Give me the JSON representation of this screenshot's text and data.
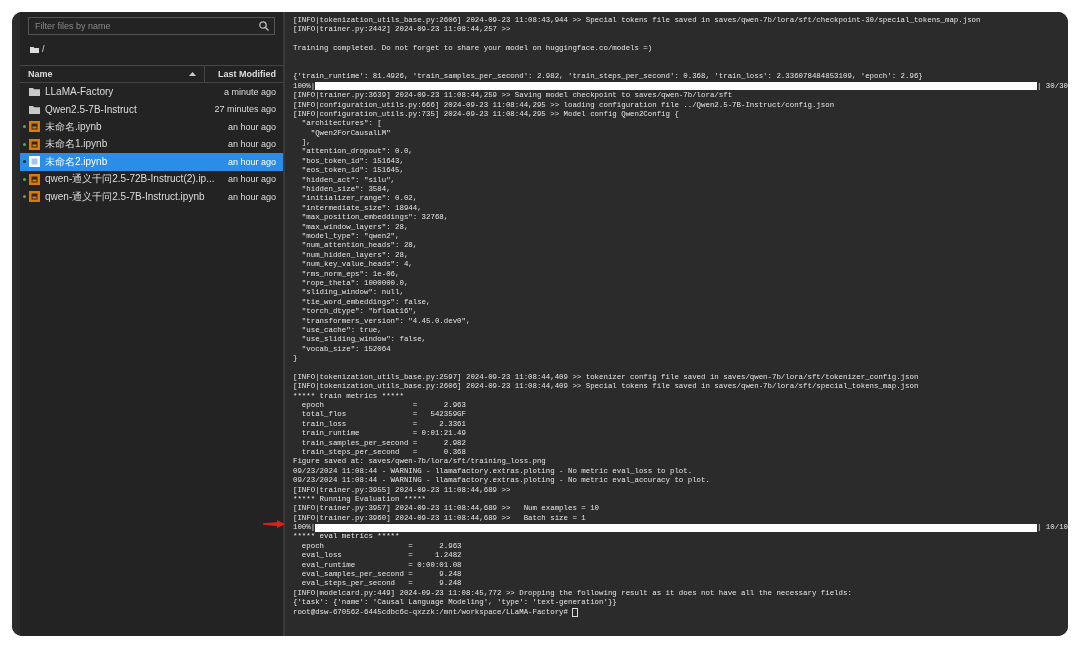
{
  "sidebar": {
    "search": {
      "placeholder": "Filter files by name"
    },
    "breadcrumb": "/",
    "columns": [
      {
        "label": "Name",
        "sorted": true
      },
      {
        "label": "Last Modified",
        "sorted": false
      }
    ],
    "files": [
      {
        "kind": "folder",
        "name": "LLaMA-Factory",
        "modified": "a minute ago",
        "running": false,
        "selected": false
      },
      {
        "kind": "folder",
        "name": "Qwen2.5-7B-Instruct",
        "modified": "27 minutes ago",
        "running": false,
        "selected": false
      },
      {
        "kind": "notebook",
        "name": "未命名.ipynb",
        "modified": "an hour ago",
        "running": true,
        "selected": false
      },
      {
        "kind": "notebook",
        "name": "未命名1.ipynb",
        "modified": "an hour ago",
        "running": true,
        "selected": false
      },
      {
        "kind": "notebook",
        "name": "未命名2.ipynb",
        "modified": "an hour ago",
        "running": true,
        "selected": true
      },
      {
        "kind": "notebook",
        "name": "qwen-通义千问2.5-72B-Instruct(2).ip...",
        "modified": "an hour ago",
        "running": true,
        "selected": false
      },
      {
        "kind": "notebook",
        "name": "qwen-通义千问2.5-7B-Instruct.ipynb",
        "modified": "an hour ago",
        "running": true,
        "selected": false
      }
    ]
  },
  "terminal": {
    "lines": [
      {
        "kind": "text",
        "text": "[INFO|tokenization_utils_base.py:2606] 2024-09-23 11:08:43,944 >> Special tokens file saved in saves/qwen-7b/lora/sft/checkpoint-30/special_tokens_map.json"
      },
      {
        "kind": "text",
        "text": "[INFO|trainer.py:2442] 2024-09-23 11:08:44,257 >>"
      },
      {
        "kind": "blank"
      },
      {
        "kind": "text",
        "text": "Training completed. Do not forget to share your model on huggingface.co/models =)"
      },
      {
        "kind": "blank"
      },
      {
        "kind": "blank"
      },
      {
        "kind": "text",
        "text": "{'train_runtime': 81.4926, 'train_samples_per_second': 2.982, 'train_steps_per_second': 0.368, 'train_loss': 2.336078484853109, 'epoch': 2.96}"
      },
      {
        "kind": "progress",
        "prefix": "100%|",
        "level": 1,
        "suffix": "| 30/30",
        "marked": false
      },
      {
        "kind": "text",
        "text": "[INFO|trainer.py:3639] 2024-09-23 11:08:44,259 >> Saving model checkpoint to saves/qwen-7b/lora/sft"
      },
      {
        "kind": "text",
        "text": "[INFO|configuration_utils.py:666] 2024-09-23 11:08:44,295 >> loading configuration file ../Qwen2.5-7B-Instruct/config.json"
      },
      {
        "kind": "text",
        "text": "[INFO|configuration_utils.py:735] 2024-09-23 11:08:44,295 >> Model config Qwen2Config {"
      },
      {
        "kind": "text",
        "text": "  \"architectures\": ["
      },
      {
        "kind": "text",
        "text": "    \"Qwen2ForCausalLM\""
      },
      {
        "kind": "text",
        "text": "  ],"
      },
      {
        "kind": "text",
        "text": "  \"attention_dropout\": 0.0,"
      },
      {
        "kind": "text",
        "text": "  \"bos_token_id\": 151643,"
      },
      {
        "kind": "text",
        "text": "  \"eos_token_id\": 151645,"
      },
      {
        "kind": "text",
        "text": "  \"hidden_act\": \"silu\","
      },
      {
        "kind": "text",
        "text": "  \"hidden_size\": 3584,"
      },
      {
        "kind": "text",
        "text": "  \"initializer_range\": 0.02,"
      },
      {
        "kind": "text",
        "text": "  \"intermediate_size\": 18944,"
      },
      {
        "kind": "text",
        "text": "  \"max_position_embeddings\": 32768,"
      },
      {
        "kind": "text",
        "text": "  \"max_window_layers\": 28,"
      },
      {
        "kind": "text",
        "text": "  \"model_type\": \"qwen2\","
      },
      {
        "kind": "text",
        "text": "  \"num_attention_heads\": 28,"
      },
      {
        "kind": "text",
        "text": "  \"num_hidden_layers\": 28,"
      },
      {
        "kind": "text",
        "text": "  \"num_key_value_heads\": 4,"
      },
      {
        "kind": "text",
        "text": "  \"rms_norm_eps\": 1e-06,"
      },
      {
        "kind": "text",
        "text": "  \"rope_theta\": 1000000.0,"
      },
      {
        "kind": "text",
        "text": "  \"sliding_window\": null,"
      },
      {
        "kind": "text",
        "text": "  \"tie_word_embeddings\": false,"
      },
      {
        "kind": "text",
        "text": "  \"torch_dtype\": \"bfloat16\","
      },
      {
        "kind": "text",
        "text": "  \"transformers_version\": \"4.45.0.dev0\","
      },
      {
        "kind": "text",
        "text": "  \"use_cache\": true,"
      },
      {
        "kind": "text",
        "text": "  \"use_sliding_window\": false,"
      },
      {
        "kind": "text",
        "text": "  \"vocab_size\": 152064"
      },
      {
        "kind": "text",
        "text": "}"
      },
      {
        "kind": "blank"
      },
      {
        "kind": "text",
        "text": "[INFO|tokenization_utils_base.py:2597] 2024-09-23 11:08:44,409 >> tokenizer config file saved in saves/qwen-7b/lora/sft/tokenizer_config.json"
      },
      {
        "kind": "text",
        "text": "[INFO|tokenization_utils_base.py:2606] 2024-09-23 11:08:44,409 >> Special tokens file saved in saves/qwen-7b/lora/sft/special_tokens_map.json"
      },
      {
        "kind": "text",
        "text": "***** train metrics *****"
      },
      {
        "kind": "text",
        "text": "  epoch                    =      2.963"
      },
      {
        "kind": "text",
        "text": "  total_flos               =   542359GF"
      },
      {
        "kind": "text",
        "text": "  train_loss               =     2.3361"
      },
      {
        "kind": "text",
        "text": "  train_runtime            = 0:01:21.49"
      },
      {
        "kind": "text",
        "text": "  train_samples_per_second =      2.982"
      },
      {
        "kind": "text",
        "text": "  train_steps_per_second   =      0.368"
      },
      {
        "kind": "text",
        "text": "Figure saved at: saves/qwen-7b/lora/sft/training_loss.png"
      },
      {
        "kind": "text",
        "text": "09/23/2024 11:08:44 - WARNING - llamafactory.extras.ploting - No metric eval_loss to plot."
      },
      {
        "kind": "text",
        "text": "09/23/2024 11:08:44 - WARNING - llamafactory.extras.ploting - No metric eval_accuracy to plot."
      },
      {
        "kind": "text",
        "text": "[INFO|trainer.py:3955] 2024-09-23 11:08:44,689 >>"
      },
      {
        "kind": "text",
        "text": "***** Running Evaluation *****"
      },
      {
        "kind": "text",
        "text": "[INFO|trainer.py:3957] 2024-09-23 11:08:44,689 >>   Num examples = 10"
      },
      {
        "kind": "text",
        "text": "[INFO|trainer.py:3960] 2024-09-23 11:08:44,689 >>   Batch size = 1"
      },
      {
        "kind": "progress",
        "prefix": "100%|",
        "level": 1,
        "suffix": "| 10/10",
        "marked": true
      },
      {
        "kind": "text",
        "text": "***** eval metrics *****"
      },
      {
        "kind": "text",
        "text": "  epoch                   =      2.963"
      },
      {
        "kind": "text",
        "text": "  eval_loss               =     1.2482"
      },
      {
        "kind": "text",
        "text": "  eval_runtime            = 0:00:01.08"
      },
      {
        "kind": "text",
        "text": "  eval_samples_per_second =      9.248"
      },
      {
        "kind": "text",
        "text": "  eval_steps_per_second   =      9.248"
      },
      {
        "kind": "text",
        "text": "[INFO|modelcard.py:449] 2024-09-23 11:08:45,772 >> Dropping the following result as it does not have all the necessary fields:"
      },
      {
        "kind": "text",
        "text": "{'task': {'name': 'Causal Language Modeling', 'type': 'text-generation'}}"
      },
      {
        "kind": "prompt",
        "text": "root@dsw-670562-6445cdbc6c-qxzzk:/mnt/workspace/LLaMA-Factory#"
      }
    ]
  }
}
